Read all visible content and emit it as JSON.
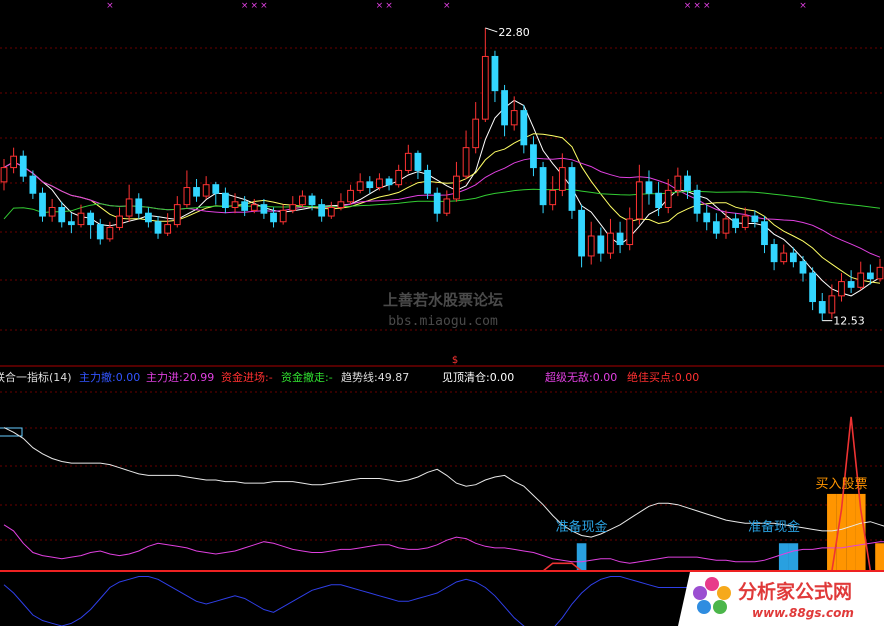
{
  "watermark": {
    "title": "上善若水股票论坛",
    "url": "bbs.miaogu.com"
  },
  "logo": {
    "name": "分析家公式网",
    "url": "www.88gs.com"
  },
  "indicator_bar": {
    "name": "联合一指标(14)",
    "items": [
      {
        "text": "主力撤:0.00",
        "color": "#3355ff"
      },
      {
        "text": "主力进:20.99",
        "color": "#e040e0"
      },
      {
        "text": "资金进场:-",
        "color": "#ff3030"
      },
      {
        "text": "资金撤走:-",
        "color": "#30e030"
      },
      {
        "text": "趋势线:49.87",
        "color": "#dddddd"
      },
      {
        "text": "见顶清仓:0.00",
        "color": "#ffffff"
      },
      {
        "text": "超级无敌:0.00",
        "color": "#e040e0"
      },
      {
        "text": "绝佳买点:0.00",
        "color": "#ff3030"
      }
    ]
  },
  "chart_data": [
    {
      "type": "candlestick",
      "title": "",
      "high_label": "22.80",
      "low_label": "12.53",
      "ylim": [
        11.5,
        23.5
      ],
      "colors": {
        "up": "#ff3333",
        "down": "#33d6ff",
        "ma5": "#ffffff",
        "ma10": "#ffff66",
        "ma20": "#e040e0",
        "ma60": "#33cc33"
      },
      "grid": true,
      "candles": [
        [
          17.4,
          17.9,
          17.1,
          18.2
        ],
        [
          17.9,
          18.3,
          17.7,
          18.6
        ],
        [
          18.3,
          17.6,
          17.4,
          18.5
        ],
        [
          17.6,
          17.0,
          16.8,
          17.8
        ],
        [
          17.0,
          16.2,
          16.0,
          17.2
        ],
        [
          16.2,
          16.5,
          16.0,
          16.8
        ],
        [
          16.5,
          16.0,
          15.8,
          16.7
        ],
        [
          16.0,
          15.9,
          15.6,
          16.3
        ],
        [
          15.9,
          16.3,
          15.8,
          16.6
        ],
        [
          16.3,
          15.9,
          15.4,
          16.4
        ],
        [
          15.9,
          15.4,
          15.2,
          16.1
        ],
        [
          15.4,
          15.8,
          15.3,
          16.0
        ],
        [
          15.8,
          16.2,
          15.7,
          16.5
        ],
        [
          16.2,
          16.8,
          16.0,
          17.3
        ],
        [
          16.8,
          16.3,
          16.1,
          17.0
        ],
        [
          16.3,
          16.0,
          15.8,
          16.5
        ],
        [
          16.0,
          15.6,
          15.4,
          16.2
        ],
        [
          15.6,
          15.9,
          15.5,
          16.3
        ],
        [
          15.9,
          16.6,
          15.8,
          16.9
        ],
        [
          16.6,
          17.2,
          16.5,
          17.8
        ],
        [
          17.2,
          16.9,
          16.7,
          17.5
        ],
        [
          16.9,
          17.3,
          16.8,
          17.6
        ],
        [
          17.3,
          17.0,
          16.6,
          17.4
        ],
        [
          17.0,
          16.5,
          16.3,
          17.2
        ],
        [
          16.5,
          16.7,
          16.3,
          17.0
        ],
        [
          16.7,
          16.4,
          16.2,
          16.9
        ],
        [
          16.4,
          16.6,
          16.3,
          16.8
        ],
        [
          16.6,
          16.3,
          16.1,
          16.8
        ],
        [
          16.3,
          16.0,
          15.8,
          16.5
        ],
        [
          16.0,
          16.4,
          15.9,
          16.6
        ],
        [
          16.4,
          16.6,
          16.3,
          16.9
        ],
        [
          16.6,
          16.9,
          16.5,
          17.1
        ],
        [
          16.9,
          16.6,
          16.4,
          17.0
        ],
        [
          16.6,
          16.2,
          16.0,
          16.8
        ],
        [
          16.2,
          16.5,
          16.1,
          16.7
        ],
        [
          16.5,
          16.7,
          16.4,
          17.0
        ],
        [
          16.7,
          17.1,
          16.6,
          17.3
        ],
        [
          17.1,
          17.4,
          17.0,
          17.7
        ],
        [
          17.4,
          17.2,
          17.0,
          17.6
        ],
        [
          17.2,
          17.5,
          17.1,
          17.7
        ],
        [
          17.5,
          17.3,
          17.1,
          17.6
        ],
        [
          17.3,
          17.8,
          17.2,
          18.0
        ],
        [
          17.8,
          18.4,
          17.7,
          18.7
        ],
        [
          18.4,
          17.8,
          17.5,
          18.5
        ],
        [
          17.8,
          17.0,
          16.8,
          18.0
        ],
        [
          17.0,
          16.3,
          16.0,
          17.2
        ],
        [
          16.3,
          16.8,
          16.2,
          17.1
        ],
        [
          16.8,
          17.6,
          16.7,
          18.1
        ],
        [
          17.6,
          18.6,
          17.5,
          19.2
        ],
        [
          18.6,
          19.6,
          18.4,
          20.2
        ],
        [
          19.6,
          21.8,
          19.5,
          22.8
        ],
        [
          21.8,
          20.6,
          20.2,
          22.0
        ],
        [
          20.6,
          19.4,
          19.0,
          20.8
        ],
        [
          19.4,
          19.9,
          19.2,
          20.4
        ],
        [
          19.9,
          18.7,
          18.4,
          20.1
        ],
        [
          18.7,
          17.9,
          17.6,
          19.0
        ],
        [
          17.9,
          16.6,
          16.3,
          18.1
        ],
        [
          16.6,
          17.1,
          16.4,
          17.6
        ],
        [
          17.1,
          17.9,
          16.9,
          18.4
        ],
        [
          17.9,
          16.4,
          16.1,
          18.1
        ],
        [
          16.4,
          14.8,
          14.4,
          16.6
        ],
        [
          14.8,
          15.5,
          14.5,
          16.0
        ],
        [
          15.5,
          14.9,
          14.6,
          15.8
        ],
        [
          14.9,
          15.6,
          14.7,
          16.1
        ],
        [
          15.6,
          15.2,
          14.9,
          16.0
        ],
        [
          15.2,
          16.1,
          15.0,
          16.5
        ],
        [
          16.1,
          17.4,
          15.9,
          18.0
        ],
        [
          17.4,
          17.0,
          16.6,
          17.8
        ],
        [
          17.0,
          16.5,
          16.2,
          17.4
        ],
        [
          16.5,
          17.1,
          16.3,
          17.5
        ],
        [
          17.1,
          17.6,
          16.9,
          17.9
        ],
        [
          17.6,
          17.1,
          16.8,
          17.8
        ],
        [
          17.1,
          16.3,
          16.0,
          17.3
        ],
        [
          16.3,
          16.0,
          15.7,
          16.6
        ],
        [
          16.0,
          15.6,
          15.4,
          16.3
        ],
        [
          15.6,
          16.1,
          15.4,
          16.4
        ],
        [
          16.1,
          15.8,
          15.6,
          16.3
        ],
        [
          15.8,
          16.2,
          15.7,
          16.5
        ],
        [
          16.2,
          16.0,
          15.8,
          16.4
        ],
        [
          16.0,
          15.2,
          14.9,
          16.2
        ],
        [
          15.2,
          14.6,
          14.3,
          15.4
        ],
        [
          14.6,
          14.9,
          14.5,
          15.2
        ],
        [
          14.9,
          14.6,
          14.4,
          15.1
        ],
        [
          14.6,
          14.2,
          13.9,
          14.8
        ],
        [
          14.2,
          13.2,
          12.9,
          14.4
        ],
        [
          13.2,
          12.8,
          12.53,
          13.5
        ],
        [
          12.8,
          13.4,
          12.6,
          13.8
        ],
        [
          13.4,
          13.9,
          13.2,
          14.2
        ],
        [
          13.9,
          13.7,
          13.5,
          14.3
        ],
        [
          13.7,
          14.2,
          13.6,
          14.6
        ],
        [
          14.2,
          14.0,
          13.8,
          14.5
        ],
        [
          14.0,
          14.4,
          13.9,
          14.7
        ]
      ]
    },
    {
      "type": "line",
      "title": "",
      "ylim": [
        -20,
        120
      ],
      "series": [
        {
          "name": "趋势线",
          "color": "#e8e8e8",
          "values": [
            93,
            90,
            86,
            80,
            76,
            73,
            71,
            70,
            70,
            70,
            70,
            69,
            67,
            65,
            63,
            62,
            62,
            62,
            62,
            61,
            60,
            59,
            59,
            58,
            58,
            57,
            57,
            57,
            58,
            58,
            58,
            57,
            56,
            56,
            57,
            58,
            59,
            60,
            60,
            60,
            59,
            58,
            59,
            61,
            64,
            66,
            62,
            57,
            55,
            56,
            59,
            61,
            62,
            58,
            55,
            49,
            43,
            36,
            30,
            26,
            23,
            22,
            24,
            27,
            30,
            34,
            38,
            42,
            44,
            44,
            43,
            41,
            39,
            37,
            35,
            33,
            32,
            31,
            31,
            31,
            31,
            30,
            29,
            28,
            27,
            26,
            26,
            27,
            29,
            31,
            32,
            30,
            28
          ]
        },
        {
          "name": "主力进",
          "color": "#e040e0",
          "values": [
            30,
            26,
            18,
            12,
            10,
            9,
            8,
            9,
            10,
            12,
            13,
            11,
            10,
            11,
            13,
            16,
            18,
            17,
            16,
            15,
            13,
            12,
            11,
            12,
            13,
            15,
            17,
            19,
            18,
            16,
            14,
            13,
            12,
            12,
            13,
            14,
            14,
            15,
            16,
            17,
            17,
            15,
            14,
            14,
            15,
            17,
            20,
            22,
            21,
            18,
            16,
            15,
            15,
            14,
            13,
            12,
            10,
            8,
            7,
            6,
            6,
            7,
            8,
            8,
            6,
            5,
            6,
            7,
            8,
            9,
            9,
            9,
            9,
            8,
            7,
            7,
            6,
            6,
            6,
            7,
            9,
            11,
            13,
            14,
            14,
            15,
            15,
            15,
            16,
            17,
            18,
            19,
            19
          ]
        },
        {
          "name": "主力撤",
          "color": "#2f3fe8",
          "values": [
            -5,
            -8,
            -12,
            -16,
            -18,
            -19,
            -20,
            -19,
            -17,
            -14,
            -10,
            -6,
            -4,
            -3,
            -2,
            -2,
            -3,
            -5,
            -7,
            -9,
            -11,
            -12,
            -11,
            -10,
            -9,
            -10,
            -12,
            -14,
            -15,
            -13,
            -11,
            -9,
            -7,
            -6,
            -5,
            -5,
            -6,
            -7,
            -8,
            -9,
            -10,
            -11,
            -11,
            -10,
            -9,
            -8,
            -6,
            -4,
            -3,
            -4,
            -6,
            -9,
            -13,
            -17,
            -20,
            -22,
            -23,
            -21,
            -17,
            -12,
            -8,
            -5,
            -3,
            -2,
            -2,
            -3,
            -4,
            -5,
            -6,
            -6,
            -6,
            -6,
            -5,
            -5,
            -5,
            -5,
            -5,
            -5,
            -5,
            -5,
            -5,
            -5,
            -5,
            -5,
            -5,
            -5,
            -5,
            -5,
            -5,
            -5,
            -5,
            -5,
            -5
          ]
        },
        {
          "name": "超级无敌",
          "color": "#ee3333",
          "values": [
            0,
            0,
            0,
            0,
            0,
            0,
            0,
            0,
            0,
            0,
            0,
            0,
            0,
            0,
            0,
            0,
            0,
            0,
            0,
            0,
            0,
            0,
            0,
            0,
            0,
            0,
            0,
            0,
            0,
            0,
            0,
            0,
            0,
            0,
            0,
            0,
            0,
            0,
            0,
            0,
            0,
            0,
            0,
            0,
            0,
            0,
            0,
            0,
            0,
            0,
            0,
            0,
            0,
            0,
            0,
            0,
            0,
            5,
            5,
            5,
            0,
            0,
            0,
            0,
            0,
            0,
            0,
            0,
            0,
            0,
            0,
            0,
            0,
            0,
            0,
            0,
            0,
            0,
            0,
            0,
            0,
            0,
            0,
            0,
            0,
            0,
            0,
            40,
            100,
            40,
            0,
            0,
            0
          ]
        }
      ],
      "bars": [
        {
          "name": "准备现金",
          "color": "#29a0e0",
          "index": 60,
          "value": 18
        },
        {
          "name": "准备现金",
          "color": "#29a0e0",
          "index": 81,
          "value": 18
        },
        {
          "name": "准备现金",
          "color": "#29a0e0",
          "index": 82,
          "value": 18
        },
        {
          "name": "买入股票",
          "color": "#ff9500",
          "index": 86,
          "value": 50
        },
        {
          "name": "买入股票",
          "color": "#ff9500",
          "index": 87,
          "value": 50
        },
        {
          "name": "买入股票",
          "color": "#ff9500",
          "index": 88,
          "value": 50
        },
        {
          "name": "买入股票",
          "color": "#ff9500",
          "index": 89,
          "value": 50
        },
        {
          "name": "买入股票",
          "color": "#ff9500",
          "index": 91,
          "value": 18
        }
      ],
      "labels": [
        {
          "text": "准备现金",
          "index": 60,
          "color": "#29a0e0"
        },
        {
          "text": "准备现金",
          "index": 80,
          "color": "#29a0e0"
        },
        {
          "text": "买入股票",
          "index": 87,
          "color": "#ff9500"
        }
      ]
    }
  ]
}
